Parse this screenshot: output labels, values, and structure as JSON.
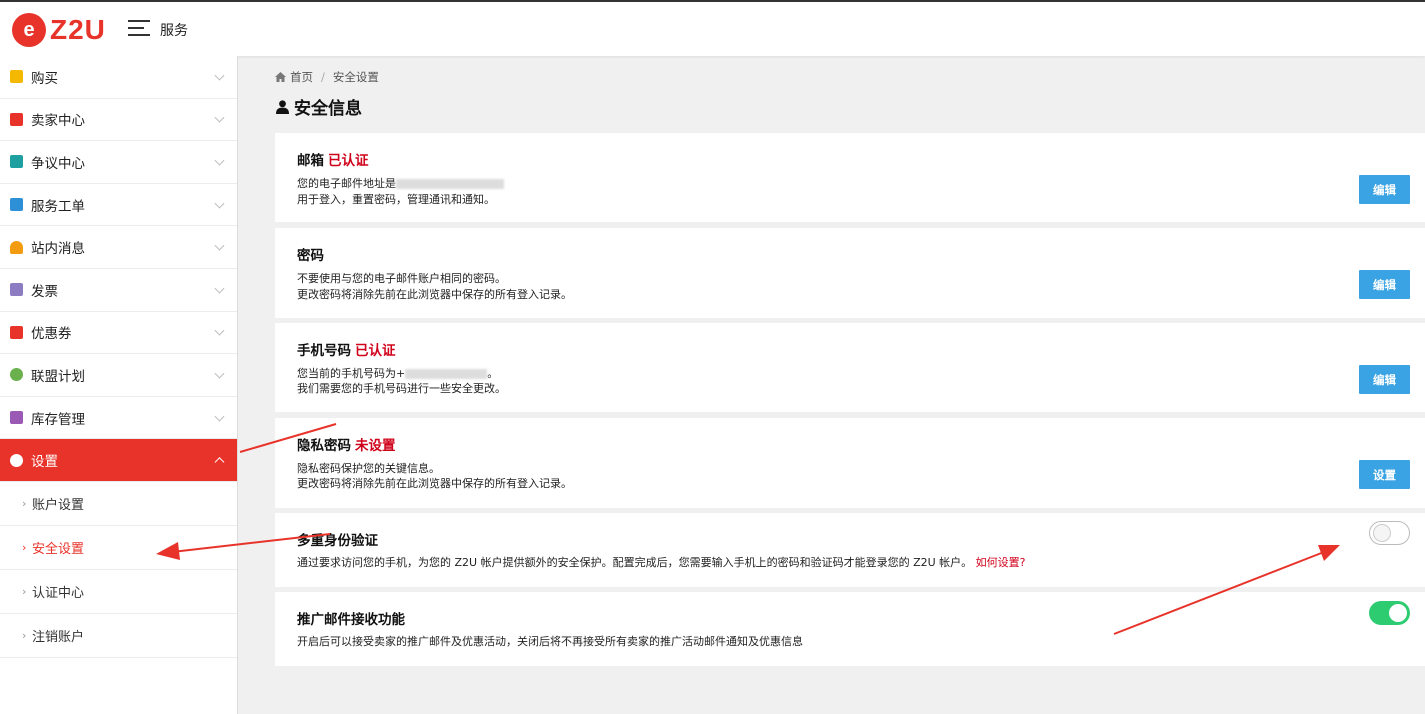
{
  "header": {
    "logo_letter": "e",
    "logo_text": "Z2U",
    "menu_title": "服务"
  },
  "sidebar": {
    "items": [
      {
        "label": "购买",
        "icon": "shopping-bag-icon",
        "color": "#f5b800"
      },
      {
        "label": "卖家中心",
        "icon": "layers-icon",
        "color": "#e8332a"
      },
      {
        "label": "争议中心",
        "icon": "gavel-icon",
        "color": "#1ea0a0"
      },
      {
        "label": "服务工单",
        "icon": "ticket-icon",
        "color": "#2d8fd5"
      },
      {
        "label": "站内消息",
        "icon": "bell-icon",
        "color": "#f39c12"
      },
      {
        "label": "发票",
        "icon": "invoice-icon",
        "color": "#8e7cc3"
      },
      {
        "label": "优惠券",
        "icon": "coupon-icon",
        "color": "#e8332a"
      },
      {
        "label": "联盟计划",
        "icon": "puzzle-icon",
        "color": "#6ab04c"
      },
      {
        "label": "库存管理",
        "icon": "cubes-icon",
        "color": "#9b59b6"
      },
      {
        "label": "设置",
        "icon": "gear-icon",
        "color": "#ffffff"
      }
    ],
    "subitems": [
      "账户设置",
      "安全设置",
      "认证中心",
      "注销账户"
    ],
    "accent": "#e8332a"
  },
  "breadcrumb": {
    "home": "首页",
    "sep": "/",
    "current": "安全设置"
  },
  "page_title": "安全信息",
  "cards": {
    "email": {
      "title": "邮箱",
      "status": "已认证",
      "line1_prefix": "您的电子邮件地址是",
      "line2": "用于登入，重置密码，管理通讯和通知。",
      "button": "编辑"
    },
    "password": {
      "title": "密码",
      "line1": "不要使用与您的电子邮件账户相同的密码。",
      "line2": "更改密码将消除先前在此浏览器中保存的所有登入记录。",
      "button": "编辑"
    },
    "phone": {
      "title": "手机号码",
      "status": "已认证",
      "line1_prefix": "您当前的手机号码为+",
      "line1_suffix": "。",
      "line2": "我们需要您的手机号码进行一些安全更改。",
      "button": "编辑"
    },
    "privacy": {
      "title": "隐私密码",
      "status": "未设置",
      "line1": "隐私密码保护您的关键信息。",
      "line2": "更改密码将消除先前在此浏览器中保存的所有登入记录。",
      "button": "设置"
    },
    "mfa": {
      "title": "多重身份验证",
      "line1": "通过要求访问您的手机，为您的 Z2U 帐户提供额外的安全保护。配置完成后，您需要输入手机上的密码和验证码才能登录您的 Z2U 帐户。",
      "link": "如何设置?",
      "enabled": false
    },
    "promo": {
      "title": "推广邮件接收功能",
      "line1": "开启后可以接受卖家的推广邮件及优惠活动，关闭后将不再接受所有卖家的推广活动邮件通知及优惠信息",
      "enabled": true
    }
  },
  "colors": {
    "button": "#3aa3e3",
    "status_red": "#d0021b",
    "toggle_on": "#2ecc71",
    "annotation_arrow": "#e8332a"
  }
}
